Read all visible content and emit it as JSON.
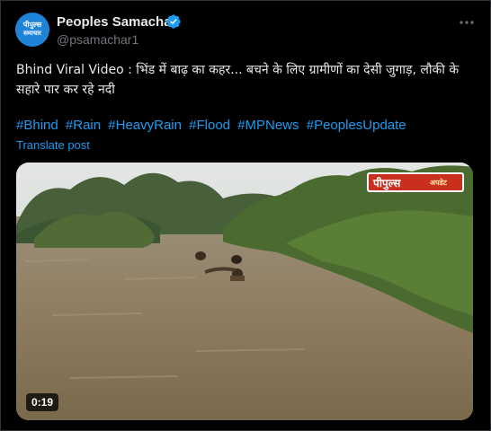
{
  "post": {
    "author_name": "Peoples Samachar",
    "handle": "@psamachar1",
    "avatar_text_top": "पीपुल्स",
    "avatar_text_bottom": "समाचार",
    "text": "Bhind Viral Video : भिंड में बाढ़ का कहर... बचने के लिए ग्रामीणों का देसी जुगाड़, लौकी के सहारे पार कर रहे नदी",
    "hashtags": [
      "#Bhind",
      "#Rain",
      "#HeavyRain",
      "#Flood",
      "#MPNews",
      "#PeoplesUpdate"
    ],
    "translate_label": "Translate post"
  },
  "media": {
    "logo_main": "पीपुल्स",
    "logo_sub": "अपडेट",
    "duration": "0:19",
    "logo_color": "#c92f1d"
  },
  "icons": {
    "verified": "verified-badge-icon",
    "more": "more-options-icon"
  },
  "colors": {
    "background": "#000000",
    "text": "#e7e9ea",
    "muted": "#71767b",
    "link": "#1d9bf0"
  }
}
